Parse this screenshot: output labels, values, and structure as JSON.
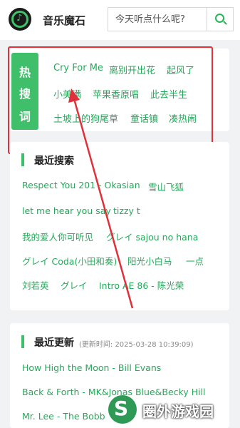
{
  "header": {
    "app_title": "音乐魔石",
    "search_placeholder": "今天听点什么呢?"
  },
  "hot": {
    "label_chars": [
      "热",
      "搜",
      "词"
    ],
    "words": [
      "Cry For Me",
      "离别开出花",
      "起风了",
      "小美满",
      "苹果香原唱",
      "此去半生",
      "土坡上的狗尾草",
      "童话镇",
      "凑热闹"
    ]
  },
  "recent_search": {
    "title": "最近搜索",
    "items": [
      "Respect You 201 - Okasian",
      "雪山飞狐",
      "let me hear you say",
      "tizzy t",
      "我的爱人你可听见",
      "グレイ sajou no hana",
      "グレイ Coda(小田和奏)",
      "阳光小白马",
      "一点",
      "刘若英",
      "グレイ",
      "Intro AE 86 - 陈光荣"
    ]
  },
  "recent_update": {
    "title": "最近更新",
    "time_text": "(更新时间: 2025-03-28 10:39:09)",
    "items": [
      "How High the Moon - Bill Evans",
      "Back & Forth - MK&Jonas Blue&Becky Hill",
      "Mr. Lee - The Bobb"
    ]
  },
  "watermark": {
    "text": "圈外游戏园"
  },
  "colors": {
    "accent": "#3fbf6a",
    "link": "#25a85a",
    "annotation": "#e0303a"
  }
}
